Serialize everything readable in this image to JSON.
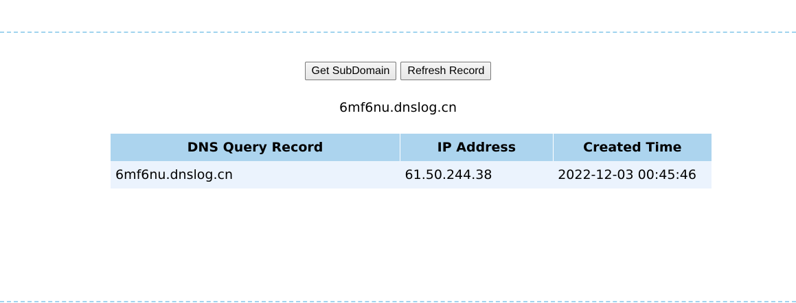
{
  "toolbar": {
    "get_subdomain_label": "Get SubDomain",
    "refresh_record_label": "Refresh Record"
  },
  "current_subdomain": "6mf6nu.dnslog.cn",
  "table": {
    "headers": [
      "DNS Query Record",
      "IP Address",
      "Created Time"
    ],
    "rows": [
      {
        "dns_query_record": "6mf6nu.dnslog.cn",
        "ip_address": "61.50.244.38",
        "created_time": "2022-12-03 00:45:46"
      }
    ]
  },
  "colors": {
    "divider": "#9fd3ee",
    "header_bg": "#acd4ee",
    "row_bg": "#ebf3fd"
  }
}
